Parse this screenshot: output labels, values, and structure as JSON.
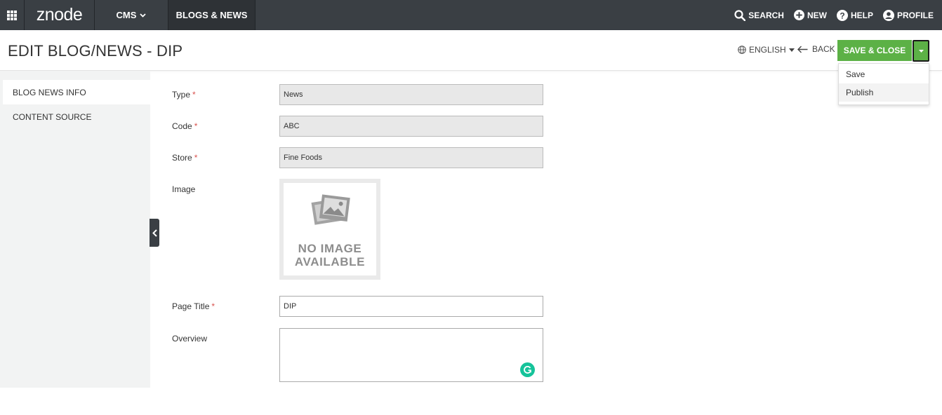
{
  "nav": {
    "logo": "znode",
    "cms_label": "CMS",
    "section_label": "BLOGS & NEWS",
    "search_label": "SEARCH",
    "new_label": "NEW",
    "help_label": "HELP",
    "profile_label": "PROFILE"
  },
  "header": {
    "title": "EDIT BLOG/NEWS  -  DIP",
    "language": "ENGLISH",
    "back_label": "BACK",
    "save_close_label": "SAVE & CLOSE"
  },
  "dropdown": {
    "items": [
      "Save",
      "Publish"
    ]
  },
  "sidebar": {
    "items": [
      {
        "label": "BLOG NEWS INFO",
        "active": true
      },
      {
        "label": "CONTENT SOURCE",
        "active": false
      }
    ]
  },
  "form": {
    "type_label": "Type",
    "type_value": "News",
    "code_label": "Code",
    "code_value": "ABC",
    "store_label": "Store",
    "store_value": "Fine Foods",
    "image_label": "Image",
    "no_image_text_1": "NO IMAGE",
    "no_image_text_2": "AVAILABLE",
    "page_title_label": "Page Title",
    "page_title_value": "DIP",
    "overview_label": "Overview",
    "overview_value": "",
    "required_marker": "*"
  },
  "colors": {
    "nav_bg": "#3a3f44",
    "primary_green": "#5cb146",
    "required_red": "#d9534f",
    "grammarly_green": "#15c39a"
  },
  "icons": {
    "app_menu": "grid-icon",
    "search": "search-icon",
    "new": "plus-circle-icon",
    "help": "help-circle-icon",
    "profile": "user-circle-icon",
    "language": "globe-icon",
    "back": "arrow-left-icon",
    "collapse": "chevron-left-icon",
    "grammarly": "grammarly-icon"
  }
}
